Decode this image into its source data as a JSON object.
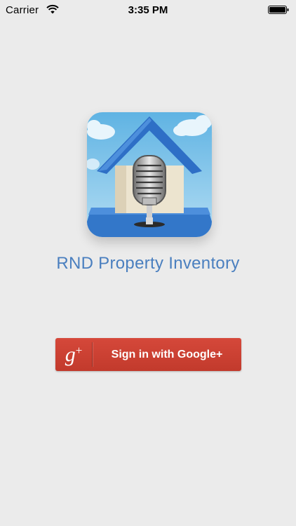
{
  "status_bar": {
    "carrier": "Carrier",
    "time": "3:35 PM",
    "icons": [
      "wifi-icon",
      "battery-icon"
    ]
  },
  "app": {
    "title": "RND Property Inventory",
    "icon": "house-microphone-icon"
  },
  "google_button": {
    "mark_g": "g",
    "mark_plus": "+",
    "label": "Sign in with Google+",
    "icon": "google-plus-icon"
  },
  "colors": {
    "background": "#ebebeb",
    "title": "#4a7fbf",
    "google_red": "#cc4133",
    "roof_blue": "#2e6fc6",
    "house_wall": "#ece4cf",
    "sky": "#7fc2e6"
  }
}
